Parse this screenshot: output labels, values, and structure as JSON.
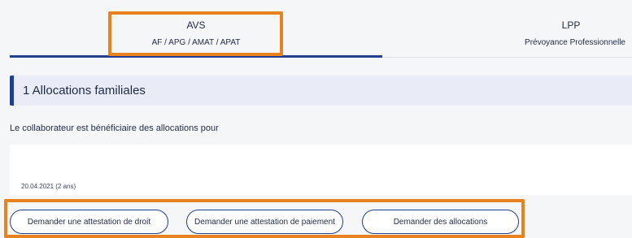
{
  "tabs": [
    {
      "title": "AVS",
      "subtitle": "AF / APG / AMAT / APAT",
      "active": true
    },
    {
      "title": "LPP",
      "subtitle": "Prévoyance Professionnelle",
      "active": false
    }
  ],
  "section": {
    "title": "1 Allocations familiales",
    "description": "Le collaborateur est bénéficiaire des allocations pour",
    "entry_date": "20.04.2021 (2 ans)"
  },
  "actions": {
    "request_right_certificate": "Demander une attestation de droit",
    "request_payment_certificate": "Demander une attestation de paiement",
    "request_allowances": "Demander des allocations"
  },
  "colors": {
    "accent": "#233d8f",
    "highlight": "#e8821e",
    "header_bg": "#e9ecf7"
  }
}
